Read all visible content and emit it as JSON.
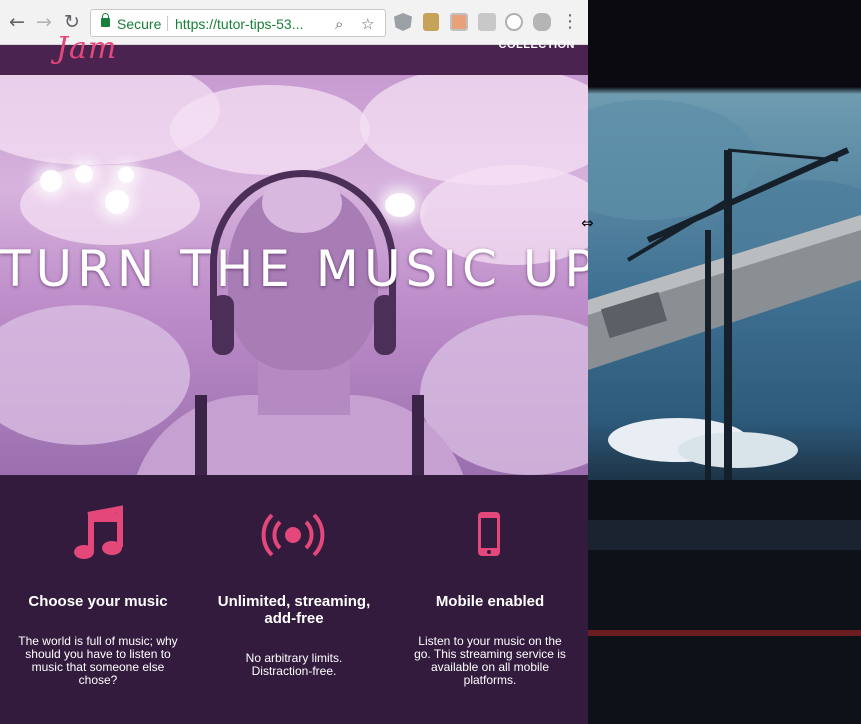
{
  "browser": {
    "security_label": "Secure",
    "url": "https://tutor-tips-53...",
    "back_icon": "arrow-left-icon",
    "forward_icon": "arrow-right-icon",
    "reload_icon": "reload-icon"
  },
  "site": {
    "nav_link": "COLLECTION"
  },
  "hero": {
    "title": "TURN THE MUSIC UP!"
  },
  "features": [
    {
      "icon": "music-note-icon",
      "title": "Choose your music",
      "description": "The world is full of music; why should you have to listen to music that someone else chose?"
    },
    {
      "icon": "broadcast-icon",
      "title": "Unlimited, streaming, add-free",
      "description": "No arbitrary limits. Distraction-free."
    },
    {
      "icon": "mobile-phone-icon",
      "title": "Mobile enabled",
      "description": "Listen to your music on the go. This streaming service is available on all mobile platforms."
    }
  ],
  "colors": {
    "accent": "#e4477a",
    "page_bg": "#331b3e",
    "header_bg": "#4a2351",
    "secure_green": "#188038"
  }
}
